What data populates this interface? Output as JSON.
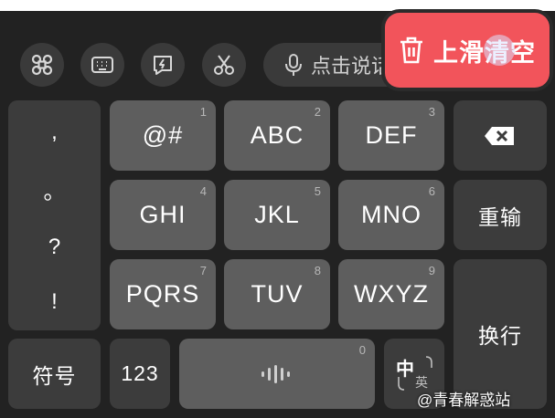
{
  "toolbar": {
    "buttons": [
      {
        "icon": "command-icon",
        "label": "functions"
      },
      {
        "icon": "keyboard-icon",
        "label": "keyboard"
      },
      {
        "icon": "chat-flash-icon",
        "label": "quick phrases"
      },
      {
        "icon": "scissors-icon",
        "label": "clipboard"
      }
    ],
    "voice_placeholder": "点击说话",
    "swipe_clear_label": "上滑清空",
    "swipe_clear_color": "#f2545b"
  },
  "punctuation": [
    ",",
    "。",
    "?",
    "!"
  ],
  "keys": {
    "k1": {
      "label": "@#",
      "num": "1"
    },
    "k2": {
      "label": "ABC",
      "num": "2"
    },
    "k3": {
      "label": "DEF",
      "num": "3"
    },
    "k4": {
      "label": "GHI",
      "num": "4"
    },
    "k5": {
      "label": "JKL",
      "num": "5"
    },
    "k6": {
      "label": "MNO",
      "num": "6"
    },
    "k7": {
      "label": "PQRS",
      "num": "7"
    },
    "k8": {
      "label": "TUV",
      "num": "8"
    },
    "k9": {
      "label": "WXYZ",
      "num": "9"
    },
    "space_num": "0"
  },
  "side": {
    "delete_icon": "backspace-icon",
    "reinput": "重输",
    "enter": "换行"
  },
  "bottom": {
    "symbols": "符号",
    "numbers": "123",
    "lang_cn": "中",
    "lang_en": "英"
  },
  "watermark": "@青春解惑站"
}
